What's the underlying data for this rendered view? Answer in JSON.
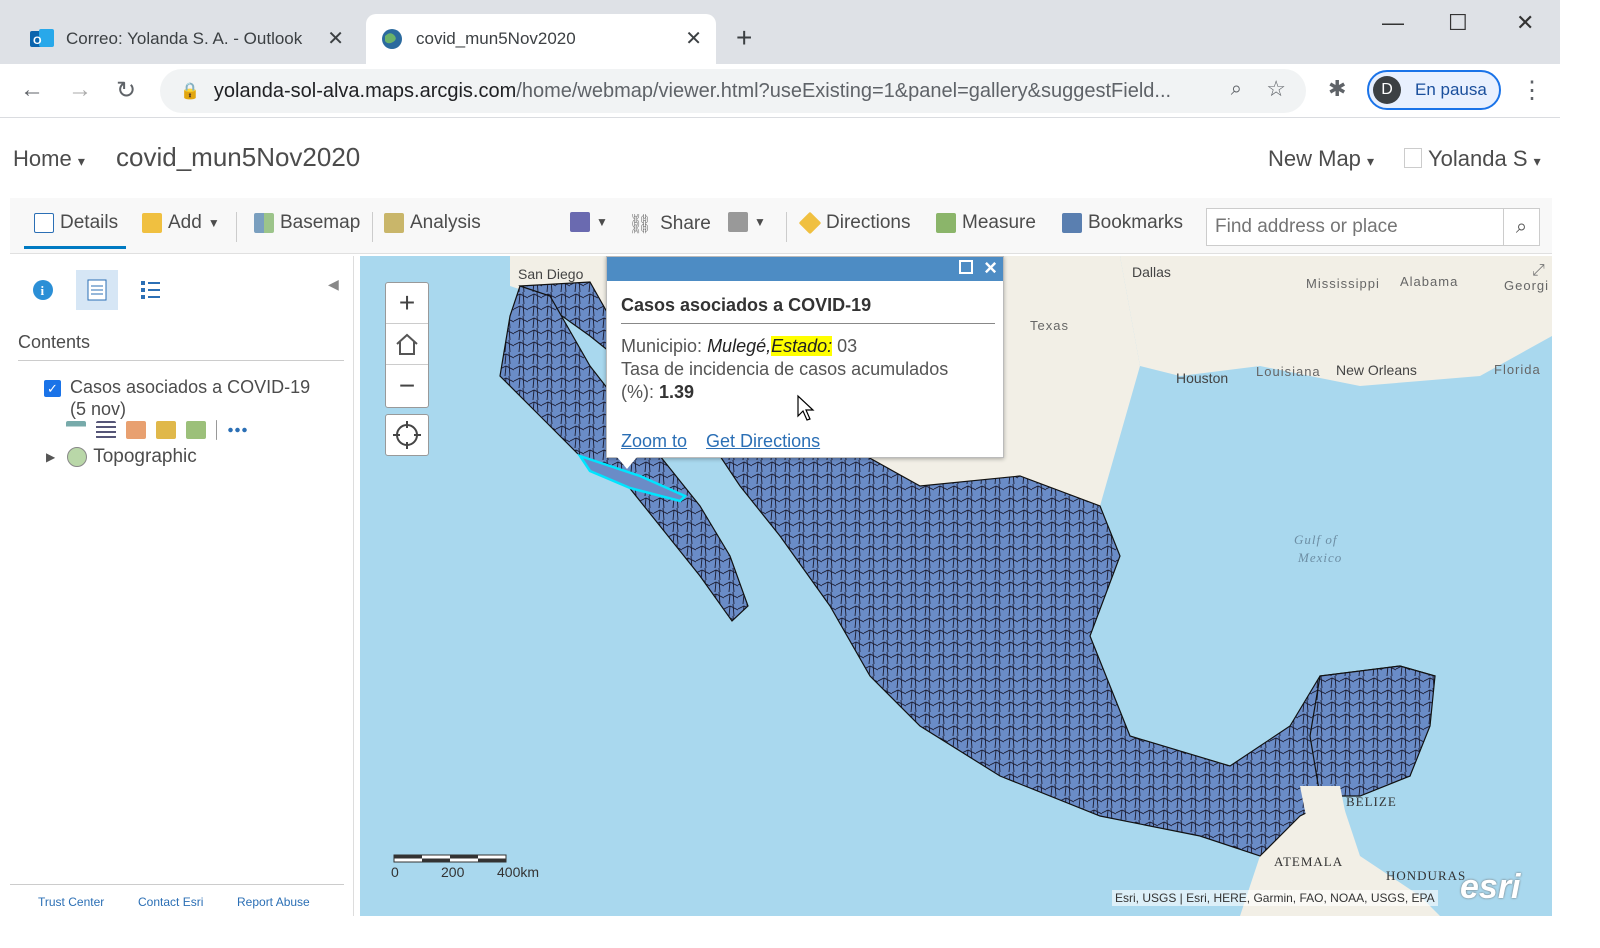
{
  "browser": {
    "tabs": [
      {
        "label": "Correo: Yolanda S. A. - Outlook",
        "icon": "outlook-icon"
      },
      {
        "label": "covid_mun5Nov2020",
        "icon": "globe-icon"
      }
    ],
    "url_host": "yolanda-sol-alva.maps.arcgis.com",
    "url_path": "/home/webmap/viewer.html?useExisting=1&panel=gallery&suggestField...",
    "profile_initial": "D",
    "profile_label": "En pausa"
  },
  "header": {
    "home": "Home",
    "map_title": "covid_mun5Nov2020",
    "new_map": "New Map",
    "user": "Yolanda S"
  },
  "toolbar": {
    "details": "Details",
    "add": "Add",
    "basemap": "Basemap",
    "analysis": "Analysis",
    "share": "Share",
    "directions": "Directions",
    "measure": "Measure",
    "bookmarks": "Bookmarks",
    "search_placeholder": "Find address or place"
  },
  "sidebar": {
    "contents_heading": "Contents",
    "layer_name": "Casos asociados a COVID-19",
    "layer_sub": "(5 nov)",
    "basemap_name": "Topographic",
    "footer": [
      "Trust Center",
      "Contact Esri",
      "Report Abuse"
    ]
  },
  "popup": {
    "title": "Casos asociados a COVID-19",
    "municipio_label": "Municipio:",
    "municipio_value": "Mulegé,",
    "estado_label": "Estado:",
    "estado_value": "03",
    "tasa_label": "Tasa de incidencia de casos acumulados",
    "tasa_unit": "(%):",
    "tasa_value": "1.39",
    "zoom_to": "Zoom to",
    "directions": "Get Directions"
  },
  "map": {
    "places": [
      "San Diego",
      "Dallas",
      "Texas",
      "Mississippi",
      "Alabama",
      "Georgi",
      "Houston",
      "Louisiana",
      "New Orleans",
      "Florida",
      "BELIZE",
      "ATEMALA",
      "HONDURAS"
    ],
    "gulf_line1": "Gulf of",
    "gulf_line2": "Mexico",
    "scale_ticks": [
      "0",
      "200",
      "400km"
    ],
    "attribution": "Esri, USGS | Esri, HERE, Garmin, FAO, NOAA, USGS, EPA",
    "logo": "esri",
    "colors": {
      "polygon_fill": "#6a8cc7",
      "water": "#a9d8ee",
      "land": "#f2efe6",
      "highlight": "#00ffff"
    }
  }
}
